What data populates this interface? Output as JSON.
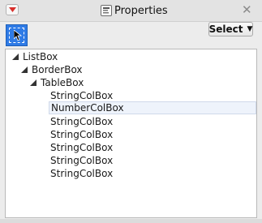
{
  "window": {
    "title": "Properties",
    "title_icon": "properties-icon",
    "menu_icon": "dropdown-menu-icon",
    "close_icon": "close-icon"
  },
  "toolbar": {
    "arrow_tool_icon": "arrow-selection-icon",
    "select_label": "Select",
    "select_caret_icon": "caret-down-icon"
  },
  "tree": {
    "nodes": [
      {
        "label": "ListBox",
        "expanded": true
      },
      {
        "label": "BorderBox",
        "expanded": true
      },
      {
        "label": "TableBox",
        "expanded": true
      },
      {
        "label": "StringColBox"
      },
      {
        "label": "NumberColBox",
        "selected": true
      },
      {
        "label": "StringColBox"
      },
      {
        "label": "StringColBox"
      },
      {
        "label": "StringColBox"
      },
      {
        "label": "StringColBox"
      },
      {
        "label": "StringColBox"
      }
    ]
  },
  "colors": {
    "accent": "#2f7be6",
    "menu_button": "#d9302c",
    "selected_row": "#eef3fb"
  }
}
